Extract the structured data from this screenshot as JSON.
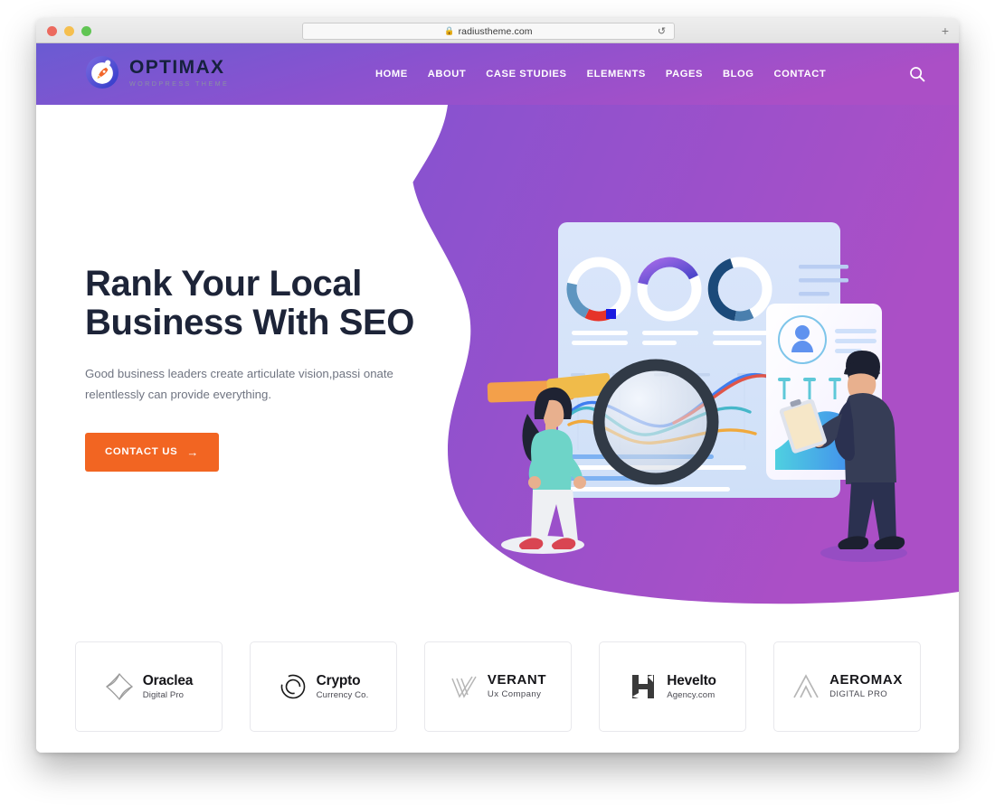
{
  "browser": {
    "url": "radiustheme.com",
    "lock_icon": "lock-icon",
    "reload_icon": "reload-icon",
    "newtab_icon": "plus-icon",
    "traffic_lights": [
      "close-red",
      "minimize-yellow",
      "zoom-green"
    ]
  },
  "header": {
    "logo": {
      "icon": "rocket-badge-icon",
      "title": "OPTIMAX",
      "subtitle": "WORDPRESS THEME"
    },
    "nav": [
      {
        "label": "HOME"
      },
      {
        "label": "ABOUT"
      },
      {
        "label": "CASE STUDIES"
      },
      {
        "label": "ELEMENTS"
      },
      {
        "label": "PAGES"
      },
      {
        "label": "BLOG"
      },
      {
        "label": "CONTACT"
      }
    ],
    "search_icon": "search-icon",
    "gradient_from": "#6a5bd2",
    "gradient_to": "#ab4fc6"
  },
  "hero": {
    "title_line1": "Rank Your Local",
    "title_line2": "Business With SEO",
    "description": "Good business leaders create articulate vision,passi onate relentlessly can provide everything.",
    "cta_label": "CONTACT US",
    "cta_arrow": "→",
    "cta_color": "#f26522",
    "title_color": "#1d2438",
    "illustration": "seo-dashboard-illustration"
  },
  "clients": [
    {
      "name": "Oraclea",
      "tagline": "Digital Pro",
      "icon": "oraclea-diamond-icon",
      "caps": false
    },
    {
      "name": "Crypto",
      "tagline": "Currency Co.",
      "icon": "crypto-ring-icon",
      "caps": false
    },
    {
      "name": "VERANT",
      "tagline": "Ux Company",
      "icon": "verant-v-icon",
      "caps": true
    },
    {
      "name": "Hevelto",
      "tagline": "Agency.com",
      "icon": "hevelto-h-icon",
      "caps": false
    },
    {
      "name": "AEROMAX",
      "tagline": "DIGITAL PRO",
      "icon": "aeromax-peak-icon",
      "caps": true
    }
  ]
}
